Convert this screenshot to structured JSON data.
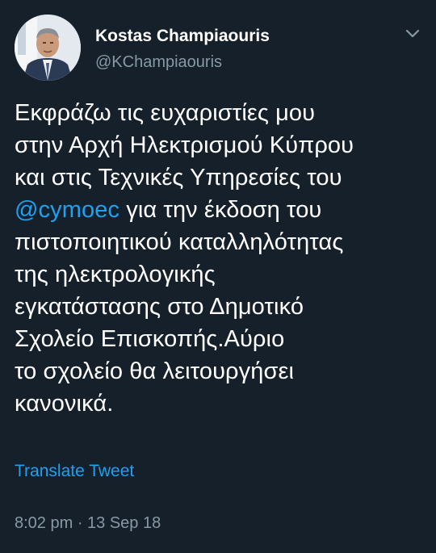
{
  "author": {
    "display_name": "Kostas Champiaouris",
    "handle": "@KChampiaouris",
    "avatar_icon": "profile-photo"
  },
  "tweet": {
    "lines": [
      "Εκφράζω τις ευχαριστίες μου",
      "στην Αρχή Ηλεκτρισμού Κύπρου",
      "και στις Τεχνικές Υπηρεσίες του",
      "",
      "πιστοποιητικού καταλληλότητας",
      "της ηλεκτρολογικής",
      "εγκατάστασης στο Δημοτικό",
      "Σχολείο Επισκοπής.Αύριο",
      "το σχολείο θα λειτουργήσει",
      "κανονικά."
    ],
    "mention": "@cymoec",
    "mention_line_rest": " για την έκδοση του"
  },
  "translate_label": "Translate Tweet",
  "timestamp": "8:02 pm · 13 Sep 18",
  "colors": {
    "background": "#15202b",
    "accent": "#1da1f2",
    "secondary_text": "#8899a6"
  }
}
